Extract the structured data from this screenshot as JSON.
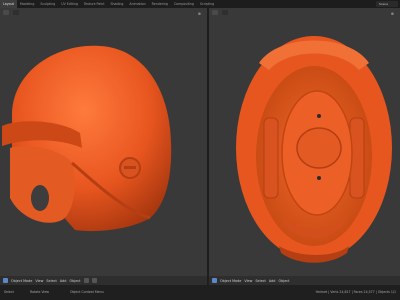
{
  "topbar": {
    "tabs": [
      "Layout",
      "Modeling",
      "Sculpting",
      "UV Editing",
      "Texture Paint",
      "Shading",
      "Animation",
      "Rendering",
      "Compositing",
      "Scripting"
    ],
    "active_index": 0,
    "scene_label": "Scene"
  },
  "left_viewport": {
    "footer": {
      "items": [
        "Object Mode",
        "View",
        "Select",
        "Add",
        "Object"
      ]
    }
  },
  "right_viewport": {
    "footer": {
      "items": [
        "Object Mode",
        "View",
        "Select",
        "Add",
        "Object"
      ]
    }
  },
  "statusbar": {
    "left": "Select",
    "mid": "Rotate View",
    "right": "Object Context Menu",
    "info": "Helmet | Verts 24,817 | Faces 24,577 | Objects 1/1"
  },
  "colors": {
    "helmet": "#e8561f",
    "helmet_dark": "#b53e12",
    "viewport_bg": "#393939"
  }
}
